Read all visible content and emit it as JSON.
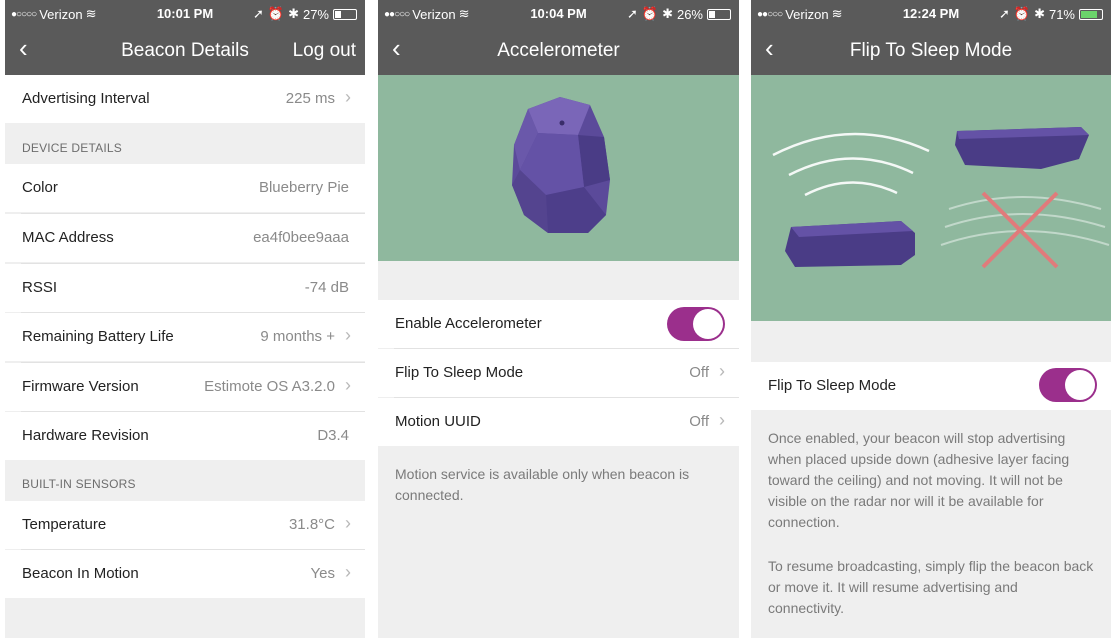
{
  "screens": [
    {
      "status": {
        "carrier": "Verizon",
        "time": "10:01 PM",
        "battery": "27%",
        "battery_level": 0.27
      },
      "nav": {
        "back_icon": "chevron-left",
        "title": "Beacon Details",
        "right": "Log out"
      },
      "rows_top": [
        {
          "label": "Advertising Interval",
          "value": "225 ms",
          "chevron": true
        }
      ],
      "section1": "DEVICE DETAILS",
      "rows_device": [
        {
          "label": "Color",
          "value": "Blueberry Pie",
          "chevron": false
        },
        {
          "label": "MAC Address",
          "value": "ea4f0bee9aaa",
          "chevron": false
        },
        {
          "label": "RSSI",
          "value": "-74 dB",
          "chevron": false
        },
        {
          "label": "Remaining Battery Life",
          "value": "9 months +",
          "chevron": true
        },
        {
          "label": "Firmware Version",
          "value": "Estimote OS A3.2.0",
          "chevron": true
        },
        {
          "label": "Hardware Revision",
          "value": "D3.4",
          "chevron": false
        }
      ],
      "section2": "BUILT-IN SENSORS",
      "rows_sensors": [
        {
          "label": "Temperature",
          "value": "31.8°C",
          "chevron": true
        },
        {
          "label": "Beacon In Motion",
          "value": "Yes",
          "chevron": true
        }
      ]
    },
    {
      "status": {
        "carrier": "Verizon",
        "time": "10:04 PM",
        "battery": "26%",
        "battery_level": 0.26
      },
      "nav": {
        "back_icon": "chevron-left",
        "title": "Accelerometer"
      },
      "rows": [
        {
          "label": "Enable Accelerometer",
          "toggle": true
        },
        {
          "label": "Flip To Sleep Mode",
          "value": "Off",
          "chevron": true
        },
        {
          "label": "Motion UUID",
          "value": "Off",
          "chevron": true
        }
      ],
      "note": "Motion service is available only when beacon is connected."
    },
    {
      "status": {
        "carrier": "Verizon",
        "time": "12:24 PM",
        "battery": "71%",
        "battery_level": 0.71
      },
      "nav": {
        "back_icon": "chevron-left",
        "title": "Flip To Sleep Mode"
      },
      "rows": [
        {
          "label": "Flip To Sleep Mode",
          "toggle": true
        }
      ],
      "note1": "Once enabled, your beacon will stop advertising when placed upside down (adhesive layer facing toward the ceiling) and not moving. It will not be visible on the radar nor will it be available for connection.",
      "note2": "To resume broadcasting, simply flip the beacon back or move it. It will resume advertising and connectivity."
    }
  ],
  "colors": {
    "nav": "#5a5a5a",
    "hero": "#8fb89e",
    "toggle_on": "#9b2f8c",
    "beacon": "#5b4a9a"
  }
}
